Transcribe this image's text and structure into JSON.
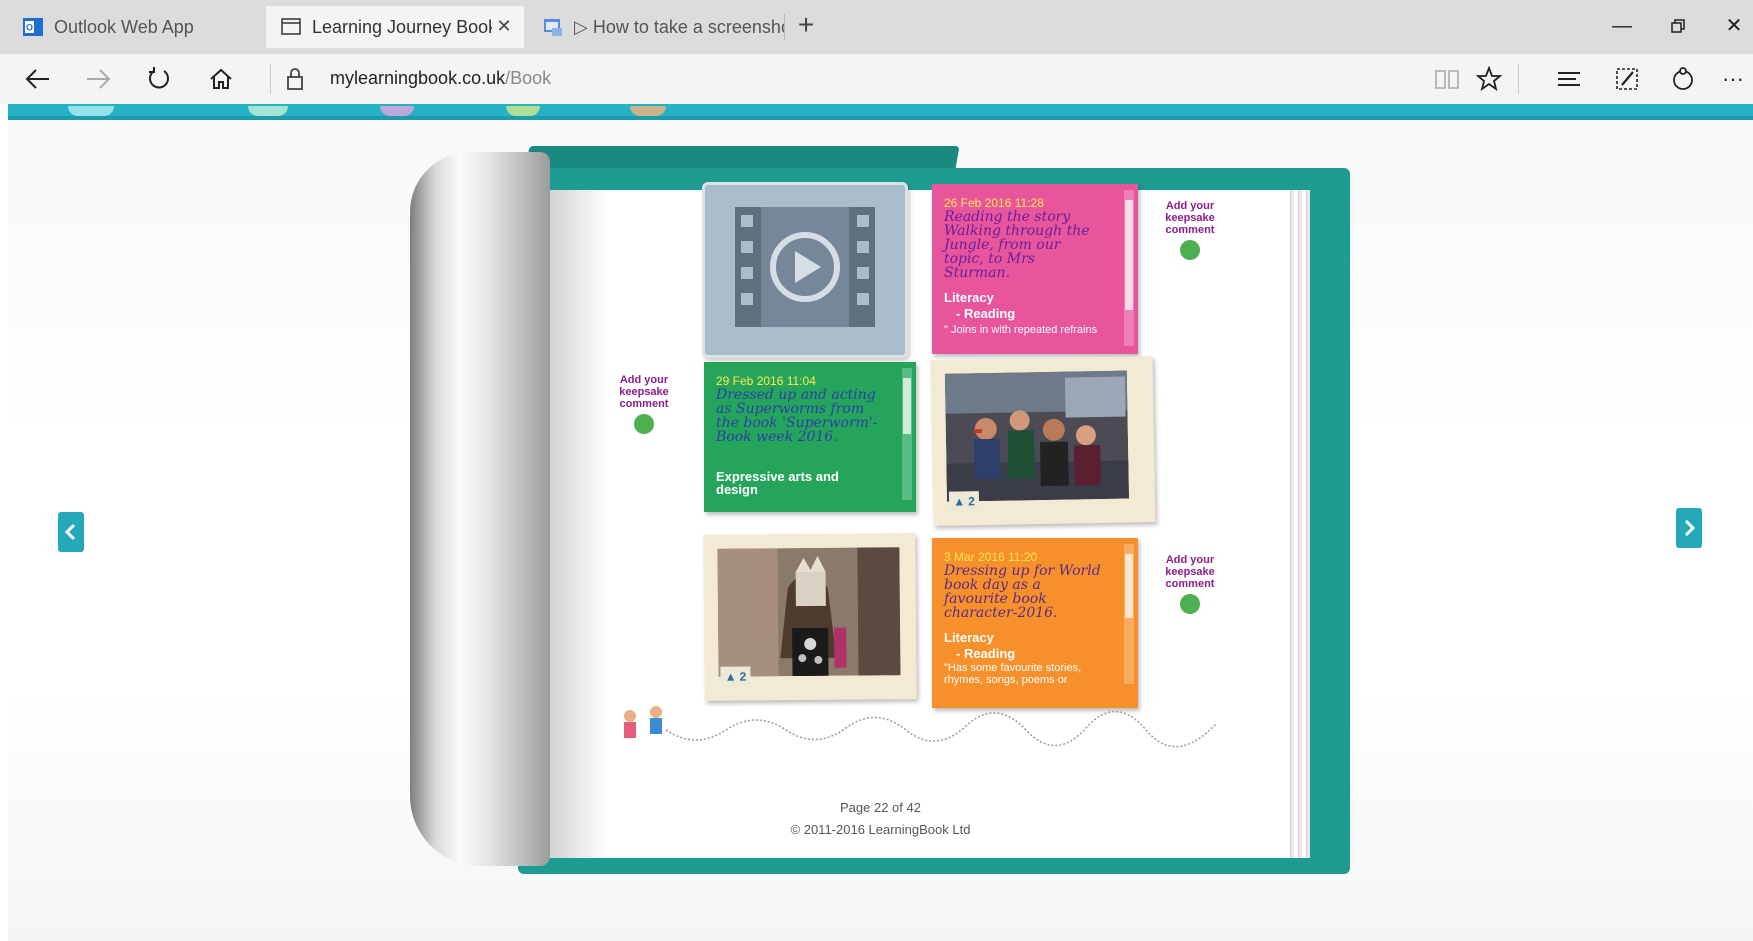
{
  "browser": {
    "tabs": [
      {
        "label": "Outlook Web App",
        "icon": "outlook-icon",
        "active": false
      },
      {
        "label": "Learning Journey Book f",
        "icon": "page-icon",
        "active": true
      },
      {
        "label": "▷ How to take a screenshot",
        "icon": "window-icon",
        "active": false
      }
    ],
    "url_domain": "mylearningbook.co.uk",
    "url_path": "/Book"
  },
  "book": {
    "cards": [
      {
        "date": "26 Feb 2016 11:28",
        "story": "Reading the story Walking through the Jungle, from our topic, to Mrs Sturman.",
        "area": "Literacy",
        "sub": "- Reading",
        "excerpt": "\" Joins in with repeated refrains",
        "color": "#e8559c"
      },
      {
        "date": "29 Feb 2016 11:04",
        "story": "Dressed up and acting as Superworms from the book 'Superworm'- Book week 2016.",
        "area": "Expressive arts and design",
        "sub": "",
        "excerpt": "",
        "color": "#25a55b"
      },
      {
        "date": "3 Mar 2016 11:20",
        "story": "Dressing up for World book day as a favourite book character-2016.",
        "area": "Literacy",
        "sub": "- Reading",
        "excerpt": "\"Has some favourite stories, rhymes, songs, poems or",
        "color": "#f7902a"
      }
    ],
    "keepsake_label": "Add your keepsake comment",
    "photo_counts": [
      "2",
      "2"
    ]
  },
  "footer": {
    "page_label": "Page 22 of 42",
    "copyright": "© 2011-2016 LearningBook Ltd"
  }
}
